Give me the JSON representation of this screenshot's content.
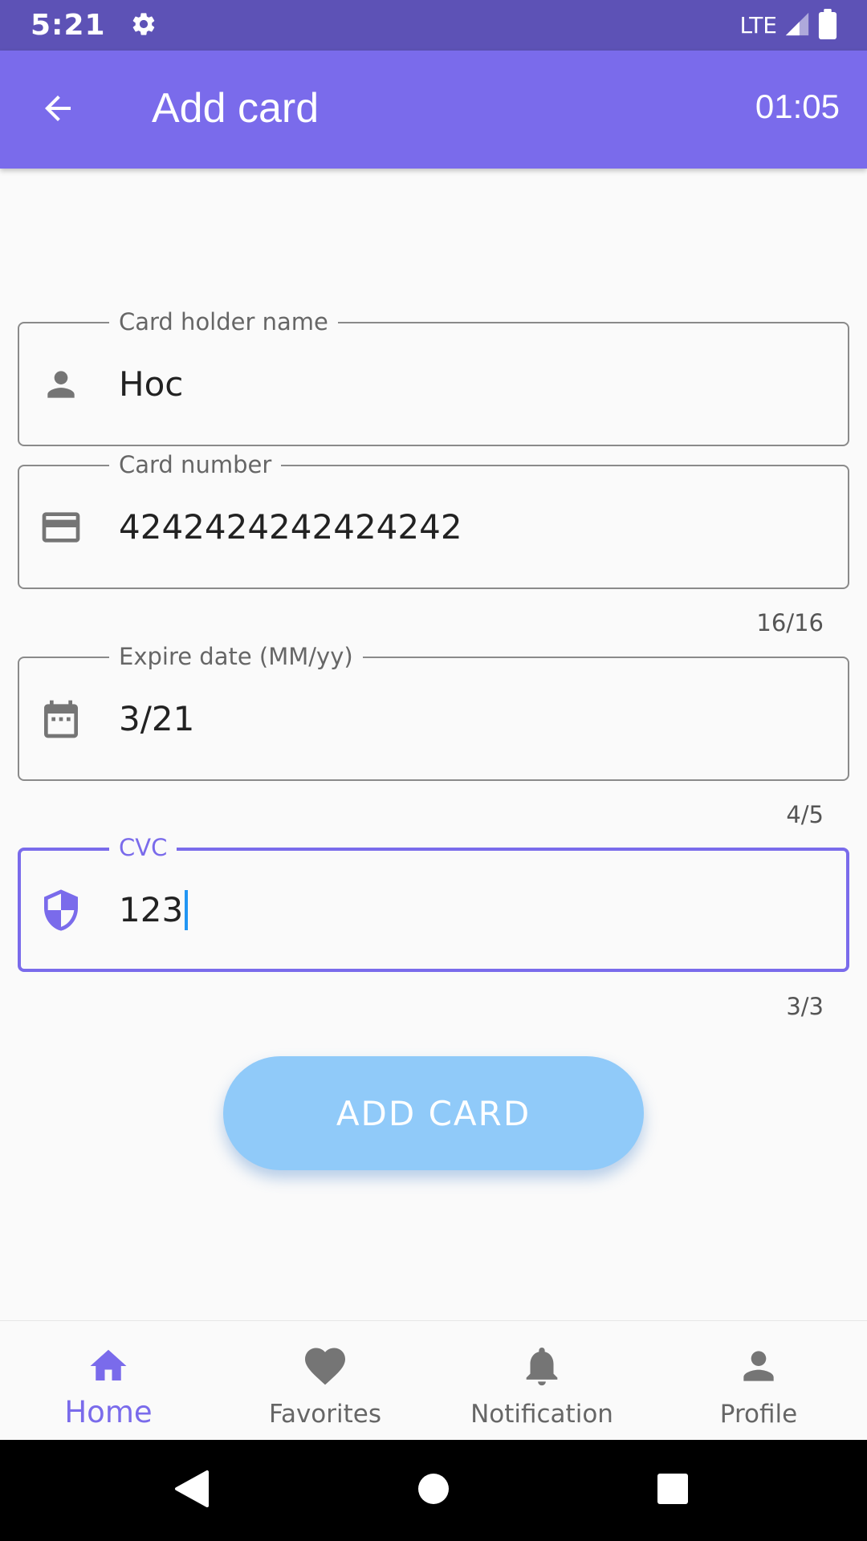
{
  "status_bar": {
    "time": "5:21",
    "network": "LTE",
    "icons": [
      "settings-icon",
      "signal-icon",
      "battery-icon"
    ]
  },
  "app_bar": {
    "back_icon": "arrow-back-icon",
    "title": "Add card",
    "timer": "01:05"
  },
  "form": {
    "card_holder": {
      "label": "Card holder name",
      "value": "Hoc",
      "icon": "person-icon"
    },
    "card_number": {
      "label": "Card number",
      "value": "4242424242424242",
      "counter": "16/16",
      "icon": "credit-card-icon"
    },
    "expire_date": {
      "label": "Expire date (MM/yy)",
      "value": "3/21",
      "counter": "4/5",
      "icon": "calendar-icon"
    },
    "cvc": {
      "label": "CVC",
      "value": "123",
      "counter": "3/3",
      "icon": "shield-icon",
      "focused": true
    }
  },
  "add_button": {
    "label": "ADD CARD"
  },
  "bottom_nav": {
    "items": [
      {
        "label": "Home",
        "icon": "home-icon",
        "active": true
      },
      {
        "label": "Favorites",
        "icon": "heart-icon",
        "active": false
      },
      {
        "label": "Notification",
        "icon": "bell-icon",
        "active": false
      },
      {
        "label": "Profile",
        "icon": "person-icon",
        "active": false
      }
    ]
  },
  "colors": {
    "status_bar": "#5d52b6",
    "primary": "#7a6beb",
    "button": "#90caf9",
    "cursor": "#2196f3"
  }
}
